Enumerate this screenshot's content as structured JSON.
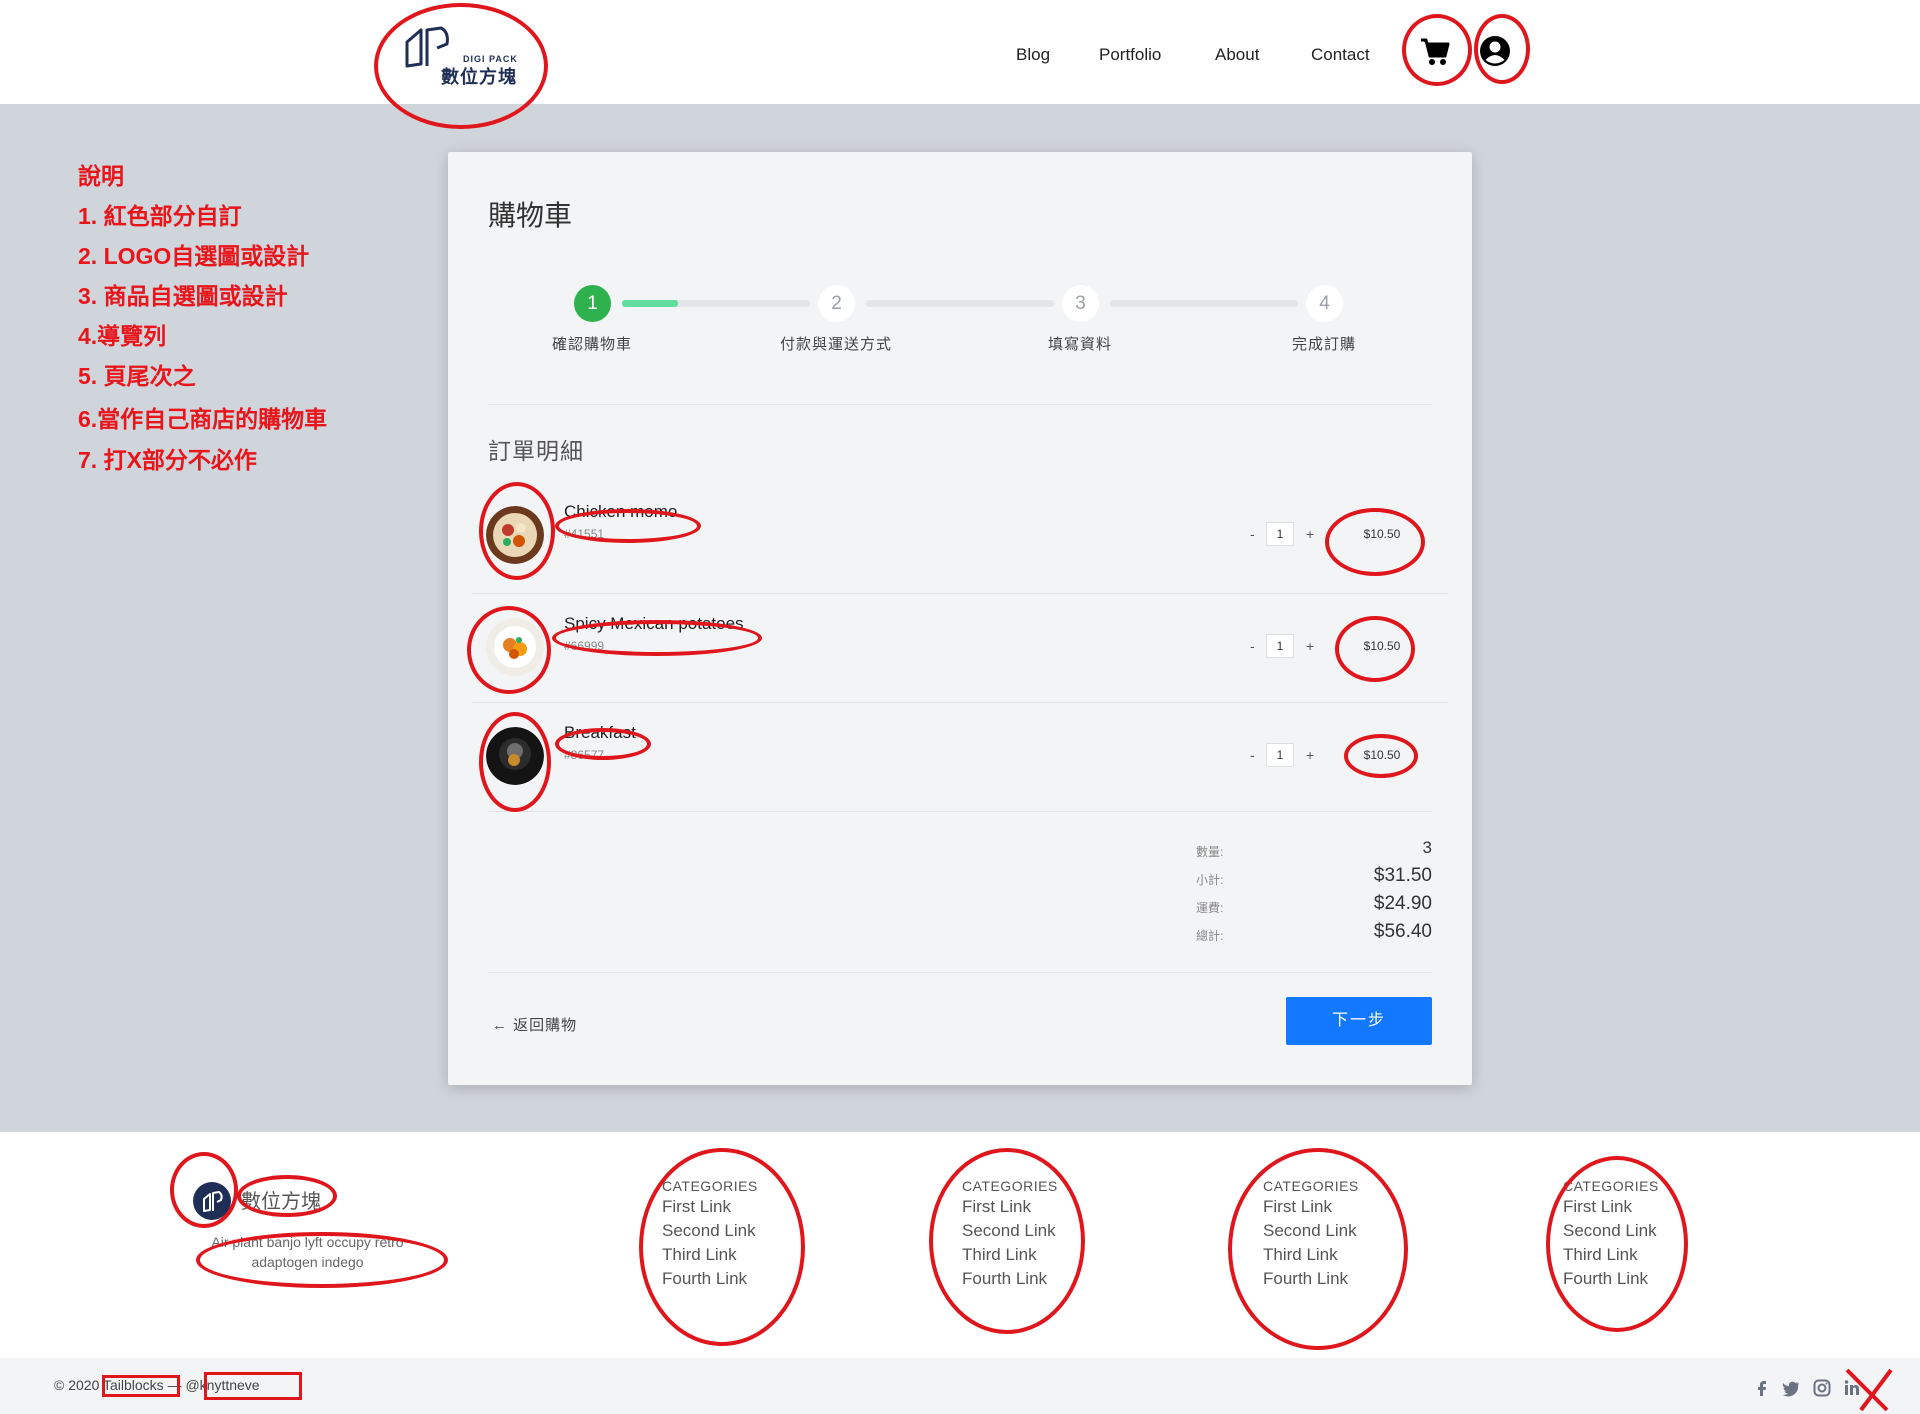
{
  "header": {
    "logo_en": "DIGI PACK",
    "logo_zh": "數位方塊",
    "nav": [
      "Blog",
      "Portfolio",
      "About",
      "Contact"
    ],
    "icons": [
      "cart-icon",
      "user-icon"
    ]
  },
  "notes": {
    "title": "說明",
    "items": [
      "1. 紅色部分自訂",
      "2. LOGO自選圖或設計",
      "3. 商品自選圖或設計",
      "4.導覽列",
      "5. 頁尾次之",
      "6.當作自己商店的購物車",
      "7. 打X部分不必作"
    ]
  },
  "cart": {
    "title": "購物車",
    "steps": [
      {
        "number": "1",
        "label": "確認購物車"
      },
      {
        "number": "2",
        "label": "付款與運送方式"
      },
      {
        "number": "3",
        "label": "填寫資料"
      },
      {
        "number": "4",
        "label": "完成訂購"
      }
    ],
    "section_title": "訂單明細",
    "items": [
      {
        "name": "Chicken momo",
        "code": "#41551",
        "qty": "1",
        "price": "$10.50"
      },
      {
        "name": "Spicy Mexican potatoes",
        "code": "#66999",
        "qty": "1",
        "price": "$10.50"
      },
      {
        "name": "Breakfast",
        "code": "#86577",
        "qty": "1",
        "price": "$10.50"
      }
    ],
    "qty_minus": "-",
    "qty_plus": "+",
    "summary": [
      {
        "label": "數量:",
        "value": "3"
      },
      {
        "label": "小計:",
        "value": "$31.50"
      },
      {
        "label": "運費:",
        "value": "$24.90"
      },
      {
        "label": "總計:",
        "value": "$56.40"
      }
    ],
    "back_label": "← 返回購物",
    "next_label": "下一步"
  },
  "footer": {
    "brand": "數位方塊",
    "desc": "Air plant banjo lyft occupy retro adaptogen indego",
    "columns": [
      {
        "title": "CATEGORIES",
        "links": [
          "First Link",
          "Second Link",
          "Third Link",
          "Fourth Link"
        ]
      },
      {
        "title": "CATEGORIES",
        "links": [
          "First Link",
          "Second Link",
          "Third Link",
          "Fourth Link"
        ]
      },
      {
        "title": "CATEGORIES",
        "links": [
          "First Link",
          "Second Link",
          "Third Link",
          "Fourth Link"
        ]
      },
      {
        "title": "CATEGORIES",
        "links": [
          "First Link",
          "Second Link",
          "Third Link",
          "Fourth Link"
        ]
      }
    ],
    "copyright": "© 2020 Tailblocks — @knyttneve",
    "social": [
      "facebook-icon",
      "twitter-icon",
      "instagram-icon",
      "linkedin-icon"
    ]
  },
  "colors": {
    "annotation": "#e0161d",
    "primary_button": "#1278ff",
    "step_active": "#2fb14e",
    "progress": "#5fdc9e"
  }
}
